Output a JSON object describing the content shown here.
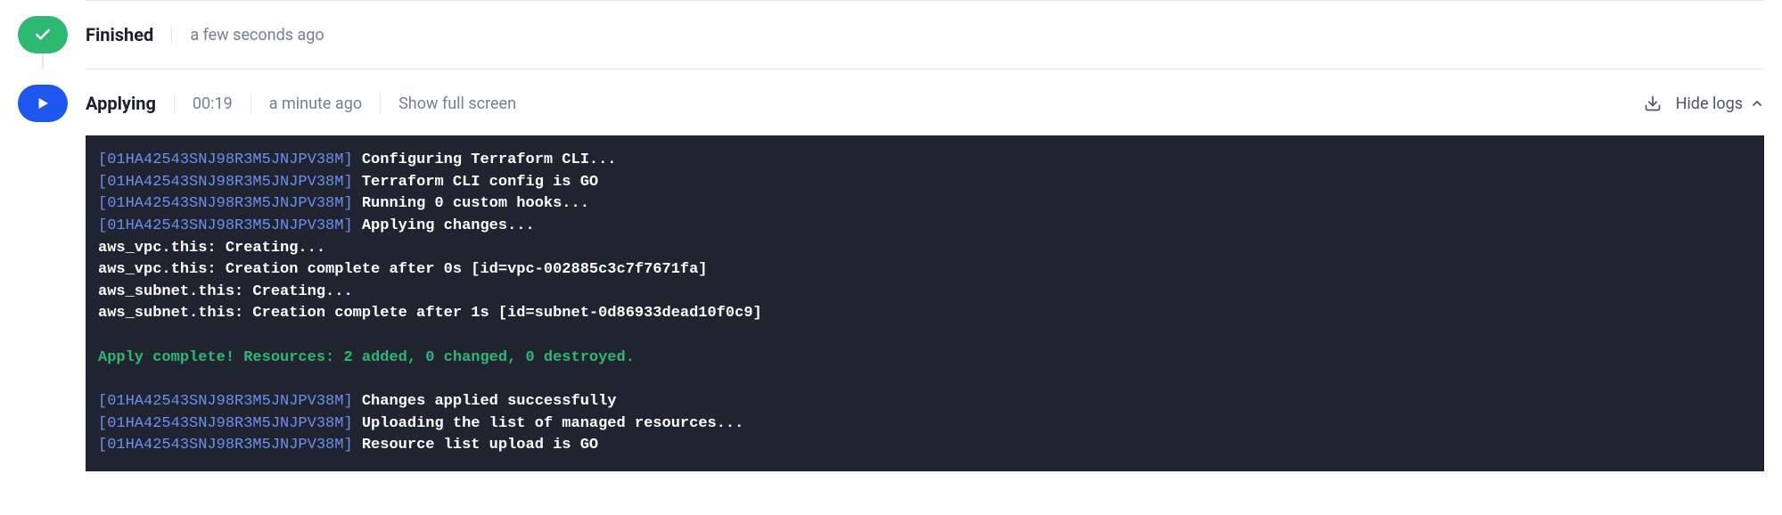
{
  "stages": {
    "finished": {
      "title": "Finished",
      "time": "a few seconds ago"
    },
    "applying": {
      "title": "Applying",
      "duration": "00:19",
      "time": "a minute ago",
      "full_screen_label": "Show full screen",
      "hide_logs_label": "Hide logs"
    }
  },
  "log": {
    "prefix": "[01HA42543SNJ98R3M5JNJPV38M]",
    "lines": [
      {
        "type": "prefixed",
        "text": "Configuring Terraform CLI..."
      },
      {
        "type": "prefixed",
        "text": "Terraform CLI config is GO"
      },
      {
        "type": "prefixed",
        "text": "Running 0 custom hooks..."
      },
      {
        "type": "prefixed",
        "text": "Applying changes..."
      },
      {
        "type": "plain",
        "text": "aws_vpc.this: Creating..."
      },
      {
        "type": "plain",
        "text": "aws_vpc.this: Creation complete after 0s [id=vpc-002885c3c7f7671fa]"
      },
      {
        "type": "plain",
        "text": "aws_subnet.this: Creating..."
      },
      {
        "type": "plain",
        "text": "aws_subnet.this: Creation complete after 1s [id=subnet-0d86933dead10f0c9]"
      },
      {
        "type": "blank"
      },
      {
        "type": "success",
        "text": "Apply complete! Resources: 2 added, 0 changed, 0 destroyed."
      },
      {
        "type": "blank"
      },
      {
        "type": "prefixed",
        "text": "Changes applied successfully"
      },
      {
        "type": "prefixed",
        "text": "Uploading the list of managed resources..."
      },
      {
        "type": "prefixed",
        "text": "Resource list upload is GO"
      }
    ]
  }
}
